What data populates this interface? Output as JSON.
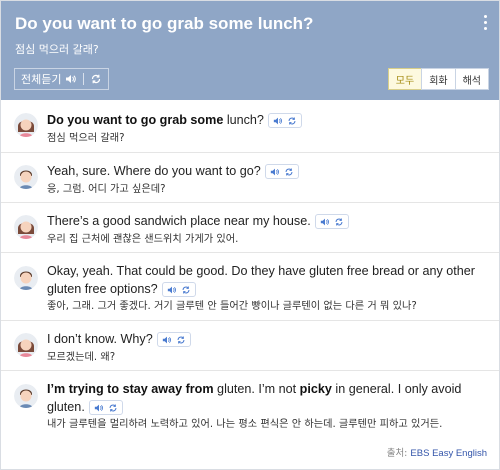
{
  "header": {
    "title": "Do you want to go grab some lunch?",
    "subtitle": "점심 먹으러 갈래?",
    "listen_all_label": "전체듣기",
    "filters": [
      {
        "label": "모두",
        "active": true
      },
      {
        "label": "회화",
        "active": false
      },
      {
        "label": "해석",
        "active": false
      }
    ]
  },
  "lines": [
    {
      "speaker": "woman",
      "en_bold": "Do you want to go grab some",
      "en_rest": " lunch?",
      "ko": "점심 먹으러 갈래?"
    },
    {
      "speaker": "man",
      "en_plain": "Yeah, sure. Where do you want to go?",
      "ko": "응, 그럼. 어디 가고 싶은데?"
    },
    {
      "speaker": "woman",
      "en_plain": "There’s a good sandwich place near my house.",
      "ko": "우리 집 근처에 괜찮은 샌드위치 가게가 있어."
    },
    {
      "speaker": "man",
      "en_line1": "Okay, yeah. That could be good. Do they have gluten free bread or any other",
      "en_line2": "gluten free options?",
      "ko": "좋아, 그래. 그거 좋겠다. 거기 글루텐 안 들어간 빵이나 글루텐이 없는 다른 거 뭐 있나?"
    },
    {
      "speaker": "woman",
      "en_plain": "I don’t know. Why?",
      "ko": "모르겠는데. 왜?"
    },
    {
      "speaker": "man",
      "en_bold1": "I’m trying to stay away from",
      "en_mid": " gluten. I’m not ",
      "en_bold2": "picky",
      "en_end": " in general. I only avoid",
      "en_line2": "gluten.",
      "ko": "내가 글루텐을 멀리하려 노력하고 있어. 나는 평소 편식은 안 하는데. 글루텐만 피하고 있거든."
    }
  ],
  "source": {
    "prefix": "출처:",
    "name": "EBS Easy English"
  },
  "icons": {
    "play": "speaker-icon",
    "repeat": "repeat-icon",
    "menu": "kebab-menu-icon"
  },
  "colors": {
    "header_bg": "#8fa6c6",
    "active_filter_bg": "#fdf9df",
    "control_blue": "#4a7bd0",
    "source_link": "#3355aa"
  }
}
